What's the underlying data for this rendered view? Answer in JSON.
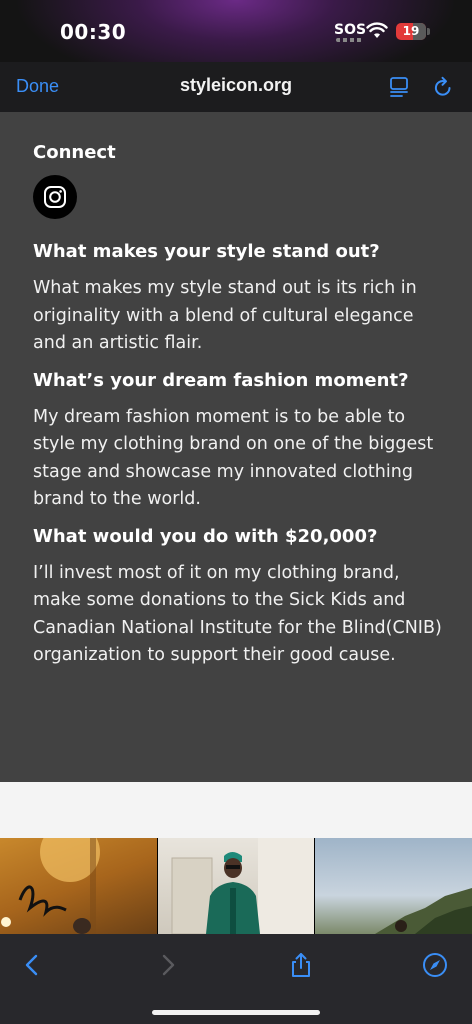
{
  "status_bar": {
    "time": "00:30",
    "sos": "SOS",
    "battery": "19"
  },
  "browser": {
    "done_label": "Done",
    "url": "styleicon.org"
  },
  "connect": {
    "title": "Connect",
    "icon": "instagram-icon"
  },
  "qa": [
    {
      "question": "What makes your style stand out?",
      "answer": "What makes my style stand out is its rich in originality with a blend of cultural elegance and an artistic flair."
    },
    {
      "question": "What’s your dream fashion moment?",
      "answer": "My dream fashion moment is to be able to style my clothing brand on one of the biggest stage and showcase my innovated clothing brand to the world."
    },
    {
      "question": "What would you do with $20,000?",
      "answer": "I’ll invest most of it on my clothing brand, make some donations to the Sick Kids and Canadian National Institute for the Blind(CNIB) organization to support their good cause."
    }
  ],
  "toolbar": {
    "icons": [
      "back-icon",
      "forward-icon",
      "share-icon",
      "compass-icon"
    ]
  },
  "colors": {
    "accent": "#3a8ef6",
    "content_bg": "#424242",
    "battery_low": "#e23a3a"
  }
}
